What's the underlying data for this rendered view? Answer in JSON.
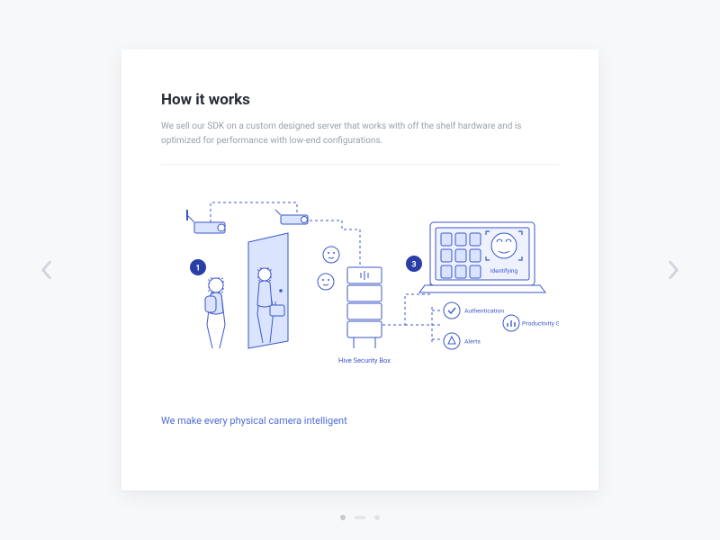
{
  "title": "How it works",
  "description": "We sell our SDK on a custom designed server that works with off the shelf hardware and is optimized for performance with low-end configurations.",
  "caption": "We make every physical camera intelligent",
  "diagram": {
    "step_1_label": "1",
    "step_3_label": "3",
    "server_label": "Hive Security Box",
    "screen_label": "Identifying",
    "benefit_auth": "Authentication",
    "benefit_prod": "Productivity Gains",
    "benefit_alerts": "Alerts"
  },
  "colors": {
    "line": "#3a56c9",
    "fill": "#dbe4ff",
    "text": "#3a56c9"
  },
  "pagination": {
    "current": 0,
    "total": 3
  }
}
